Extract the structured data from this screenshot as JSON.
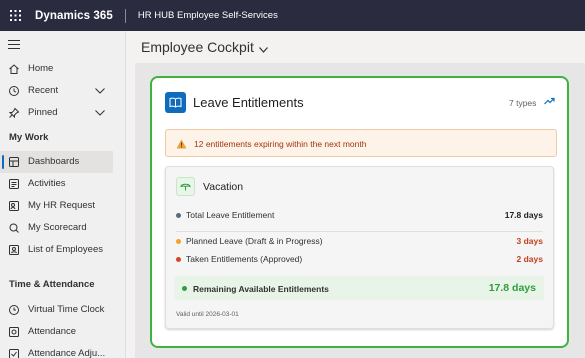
{
  "topbar": {
    "brand": "Dynamics 365",
    "app_name": "HR HUB Employee Self-Services",
    "icon_waffle": "waffle-icon"
  },
  "sidebar": {
    "items_top": [
      {
        "label": "Home",
        "icon": "home-icon"
      },
      {
        "label": "Recent",
        "icon": "clock-icon"
      },
      {
        "label": "Pinned",
        "icon": "pin-icon"
      }
    ],
    "section_my_work": "My Work",
    "items_my_work": [
      {
        "label": "Dashboards",
        "icon": "dashboard-icon",
        "active": true
      },
      {
        "label": "Activities",
        "icon": "activities-icon"
      },
      {
        "label": "My HR Request",
        "icon": "request-icon"
      },
      {
        "label": "My Scorecard",
        "icon": "scorecard-icon"
      },
      {
        "label": "List of Employees",
        "icon": "people-icon"
      }
    ],
    "section_time": "Time & Attendance",
    "items_time": [
      {
        "label": "Virtual Time Clock",
        "icon": "time-clock-icon"
      },
      {
        "label": "Attendance",
        "icon": "attendance-icon"
      },
      {
        "label": "Attendance Adju...",
        "icon": "adjustment-icon"
      }
    ]
  },
  "main": {
    "page_title": "Employee Cockpit",
    "card": {
      "title": "Leave Entitlements",
      "types_count": "7 types",
      "alert": "12 entitlements expiring within the next month",
      "vacation": {
        "title": "Vacation",
        "rows": [
          {
            "label": "Total Leave Entitlement",
            "value": "17.8 days",
            "color": "#5a6a7a",
            "value_color": "#201f1e"
          },
          {
            "label": "Planned Leave (Draft & in Progress)",
            "value": "3 days",
            "color": "#f7a128",
            "value_color": "#c43e1c"
          },
          {
            "label": "Taken Entitlements (Approved)",
            "value": "2 days",
            "color": "#d24726",
            "value_color": "#c43e1c"
          }
        ],
        "remaining": {
          "label": "Remaining Available Entitlements",
          "value": "17.8 days"
        },
        "valid_until": "Valid until 2026-03-01"
      }
    }
  },
  "colors": {
    "accent": "#0f6cbd",
    "success": "#2e9e3e",
    "card_border": "#3fb33f",
    "warning_text": "#a4370a"
  }
}
